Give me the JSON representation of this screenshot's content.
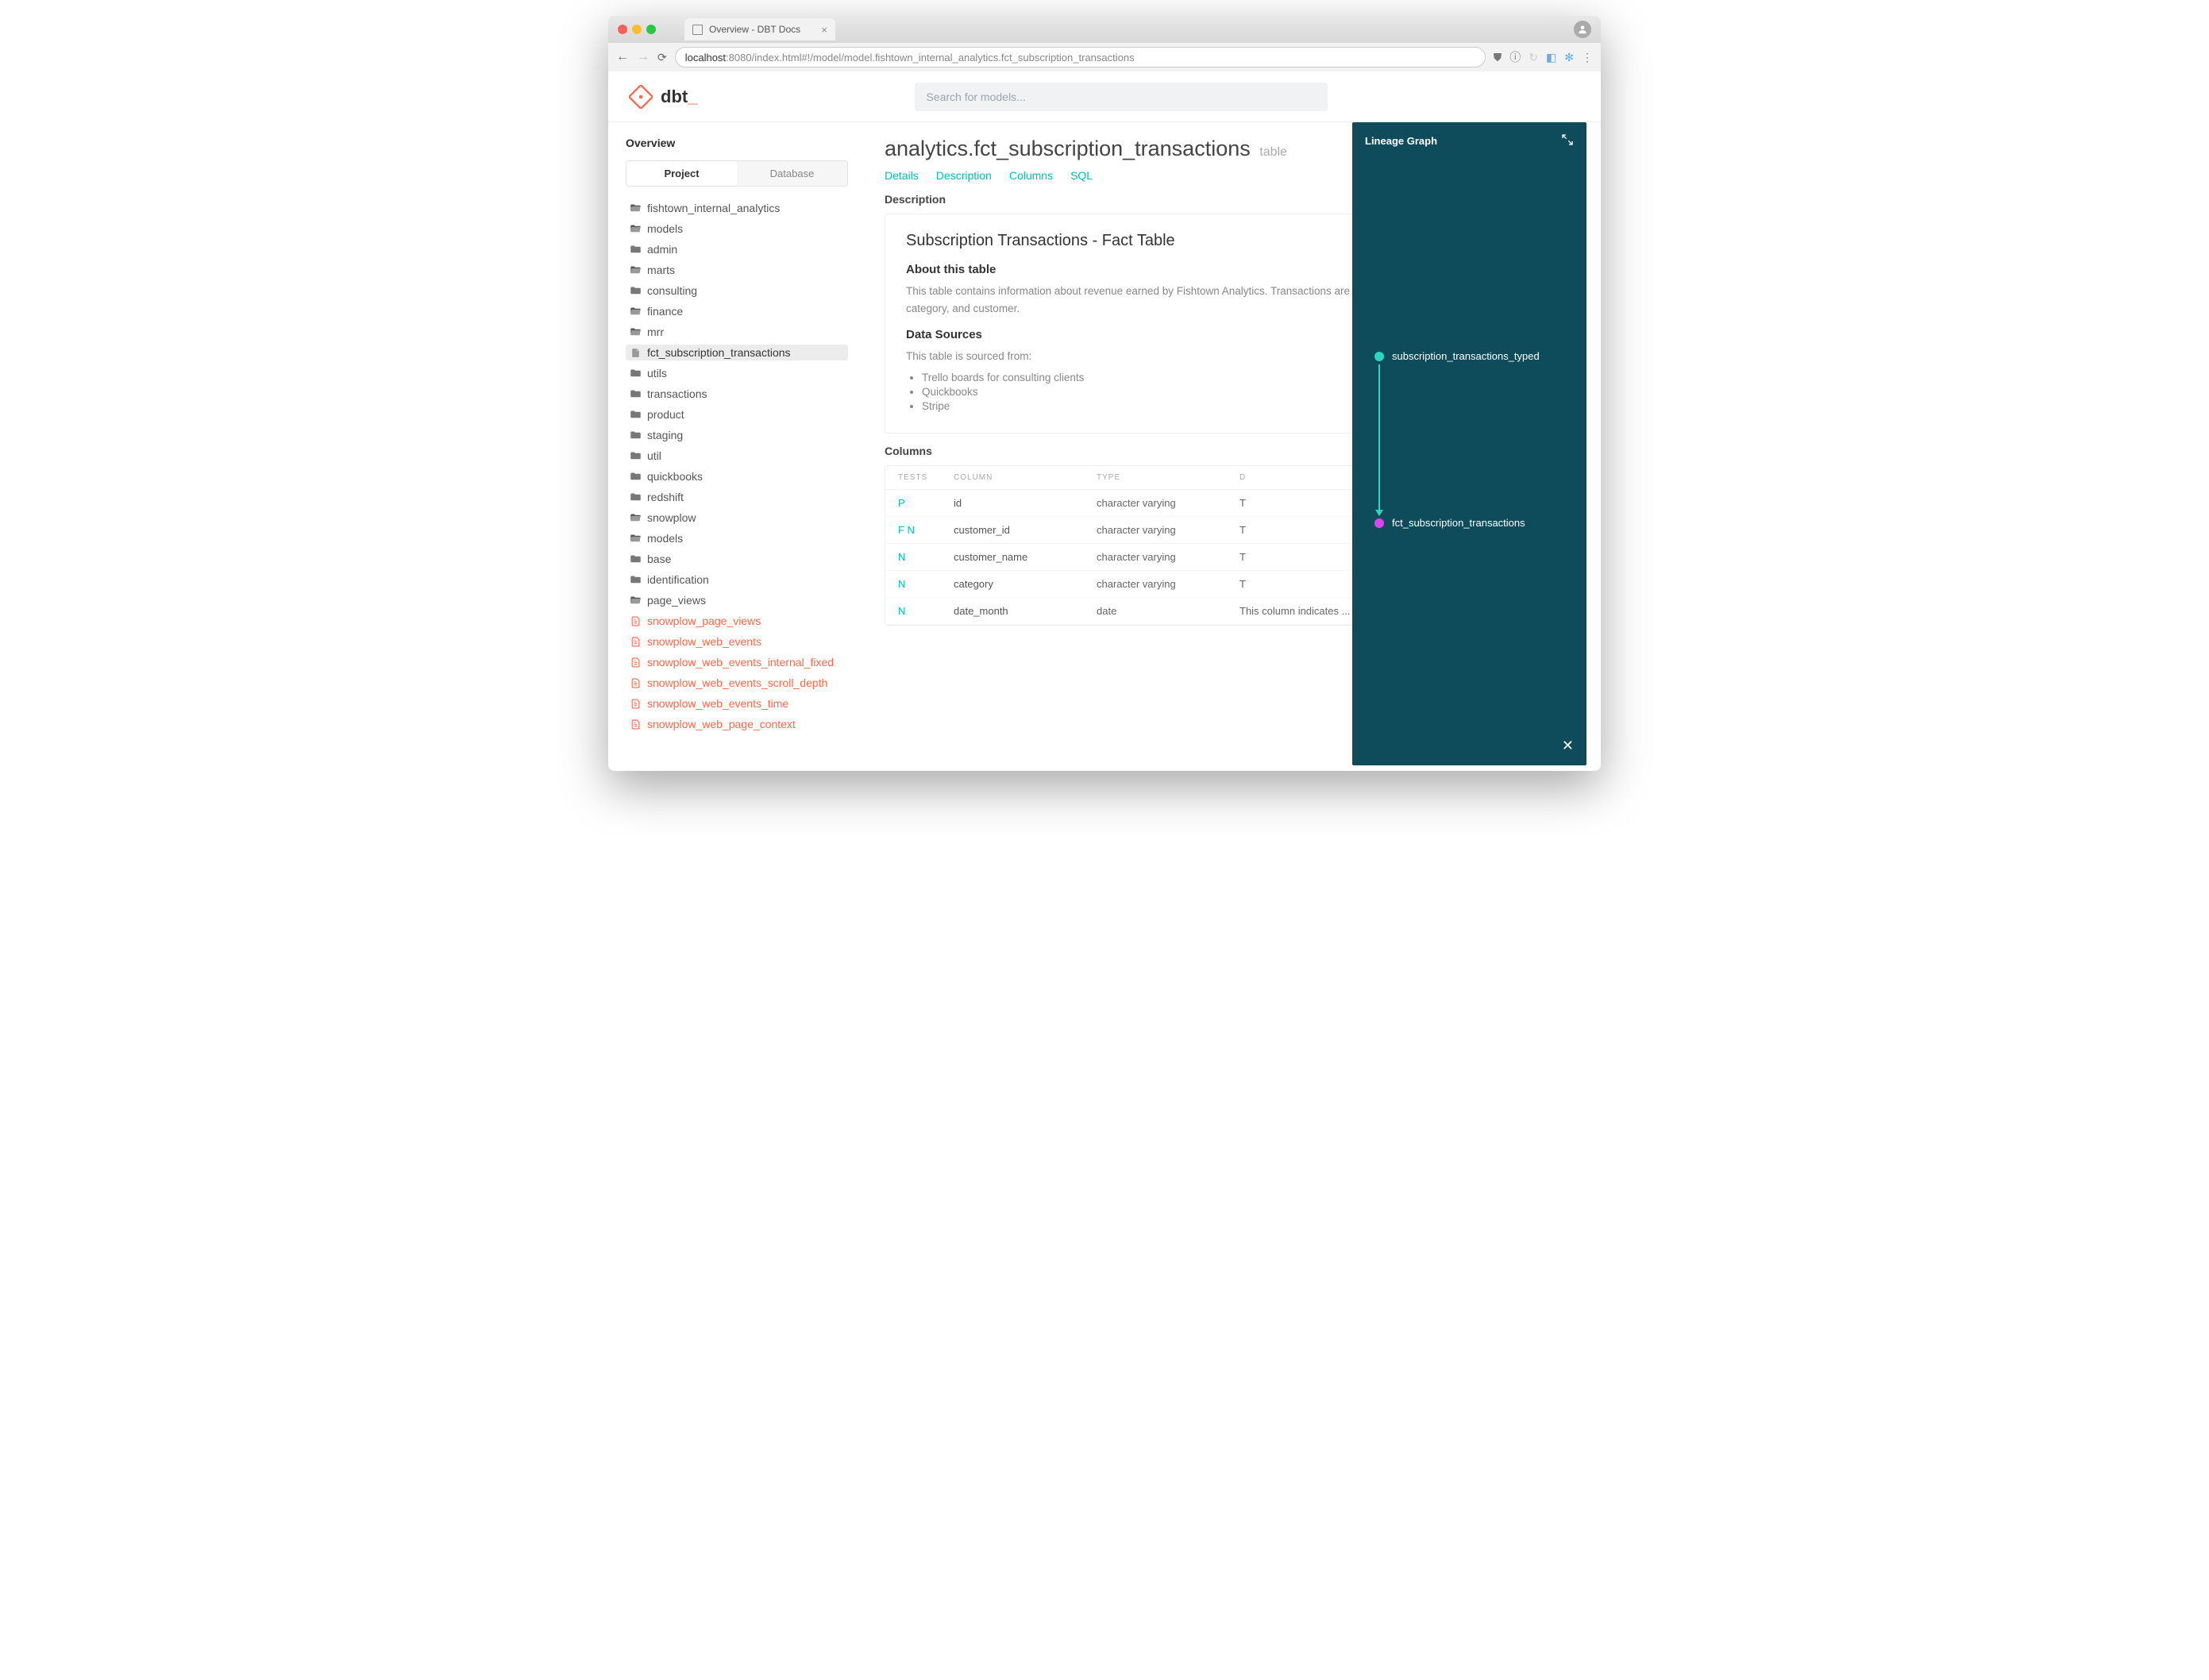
{
  "browser": {
    "tab_title": "Overview - DBT Docs",
    "url_host": "localhost",
    "url_port": ":8080",
    "url_path": "/index.html#!/model/model.fishtown_internal_analytics.fct_subscription_transactions"
  },
  "brand": "dbt",
  "search": {
    "placeholder": "Search for models..."
  },
  "sidebar": {
    "title": "Overview",
    "tabs": {
      "project": "Project",
      "database": "Database"
    },
    "tree": [
      {
        "name": "fishtown_internal_analytics",
        "kind": "folder-open",
        "depth": 0
      },
      {
        "name": "models",
        "kind": "folder-open",
        "depth": 1
      },
      {
        "name": "admin",
        "kind": "folder",
        "depth": 2
      },
      {
        "name": "marts",
        "kind": "folder-open",
        "depth": 2
      },
      {
        "name": "consulting",
        "kind": "folder",
        "depth": 3
      },
      {
        "name": "finance",
        "kind": "folder-open",
        "depth": 3
      },
      {
        "name": "mrr",
        "kind": "folder-open",
        "depth": 4
      },
      {
        "name": "fct_subscription_transactions",
        "kind": "file",
        "depth": 5,
        "selected": true
      },
      {
        "name": "utils",
        "kind": "folder",
        "depth": 5
      },
      {
        "name": "transactions",
        "kind": "folder",
        "depth": 4
      },
      {
        "name": "product",
        "kind": "folder",
        "depth": 3
      },
      {
        "name": "staging",
        "kind": "folder",
        "depth": 2
      },
      {
        "name": "util",
        "kind": "folder",
        "depth": 2
      },
      {
        "name": "quickbooks",
        "kind": "folder",
        "depth": 0
      },
      {
        "name": "redshift",
        "kind": "folder",
        "depth": 0
      },
      {
        "name": "snowplow",
        "kind": "folder-open",
        "depth": 0
      },
      {
        "name": "models",
        "kind": "folder-open",
        "depth": 1
      },
      {
        "name": "base",
        "kind": "folder",
        "depth": 2
      },
      {
        "name": "identification",
        "kind": "folder",
        "depth": 2
      },
      {
        "name": "page_views",
        "kind": "folder-open",
        "depth": 2
      },
      {
        "name": "snowplow_page_views",
        "kind": "model",
        "depth": 3
      },
      {
        "name": "snowplow_web_events",
        "kind": "model",
        "depth": 3
      },
      {
        "name": "snowplow_web_events_internal_fixed",
        "kind": "model",
        "depth": 3
      },
      {
        "name": "snowplow_web_events_scroll_depth",
        "kind": "model",
        "depth": 3
      },
      {
        "name": "snowplow_web_events_time",
        "kind": "model",
        "depth": 3
      },
      {
        "name": "snowplow_web_page_context",
        "kind": "model",
        "depth": 3
      }
    ]
  },
  "main": {
    "title": "analytics.fct_subscription_transactions",
    "subtype": "table",
    "tabs": [
      "Details",
      "Description",
      "Columns",
      "SQL"
    ],
    "sections": {
      "description_label": "Description",
      "columns_label": "Columns"
    },
    "description": {
      "heading": "Subscription Transactions - Fact Table",
      "about_heading": "About this table",
      "about_text": "This table contains information about revenue earned by Fishtown Analytics. Transactions are categorized by service type, revenue category, and customer.",
      "sources_heading": "Data Sources",
      "sources_intro": "This table is sourced from:",
      "sources": [
        "Trello boards for consulting clients",
        "Quickbooks",
        "Stripe"
      ]
    },
    "columns": {
      "headers": {
        "tests": "Tests",
        "column": "Column",
        "type": "Type",
        "desc": "D"
      },
      "rows": [
        {
          "tests": "P",
          "name": "id",
          "type": "character varying",
          "desc": "T"
        },
        {
          "tests": "F N",
          "name": "customer_id",
          "type": "character varying",
          "desc": "T"
        },
        {
          "tests": "N",
          "name": "customer_name",
          "type": "character varying",
          "desc": "T"
        },
        {
          "tests": "N",
          "name": "category",
          "type": "character varying",
          "desc": "T"
        },
        {
          "tests": "N",
          "name": "date_month",
          "type": "date",
          "desc": "This column indicates ..."
        }
      ]
    }
  },
  "lineage": {
    "title": "Lineage Graph",
    "nodes": {
      "upstream": "subscription_transactions_typed",
      "downstream": "fct_subscription_transactions"
    }
  }
}
